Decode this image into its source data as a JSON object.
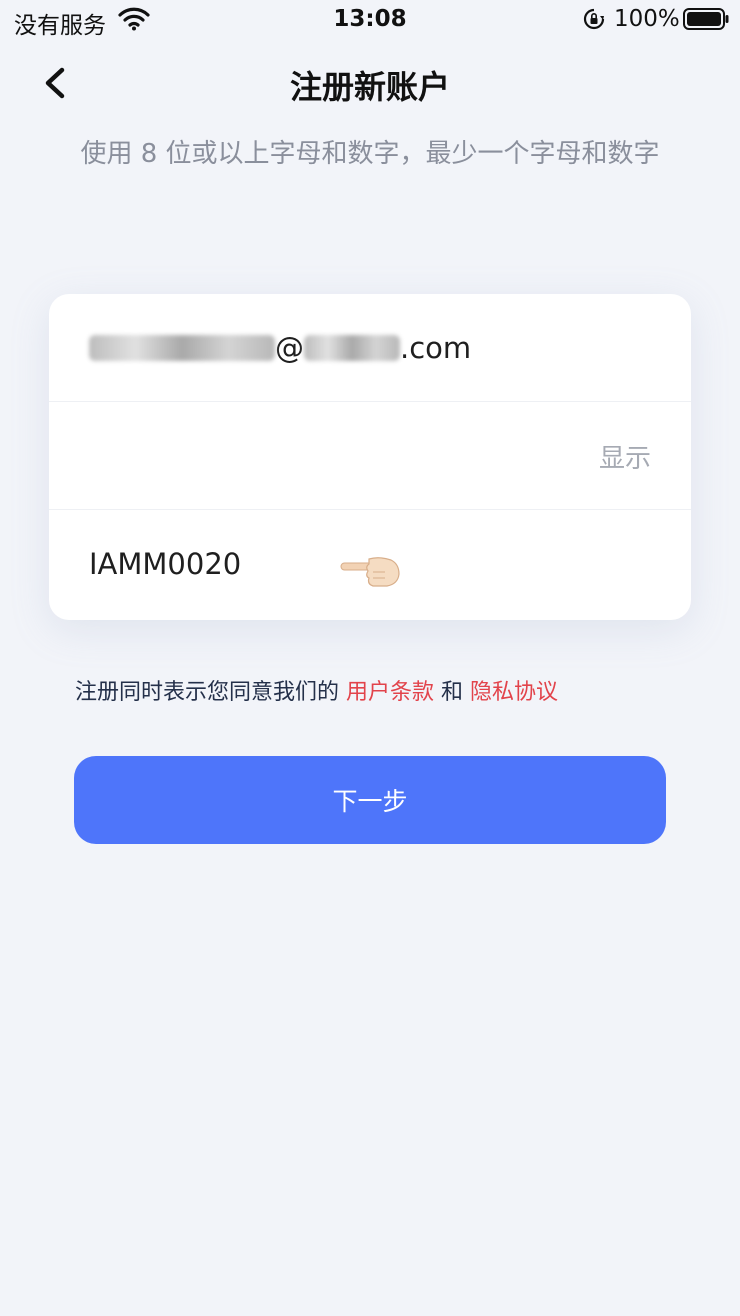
{
  "status_bar": {
    "carrier": "没有服务",
    "time": "13:08",
    "battery": "100%"
  },
  "nav": {
    "title": "注册新账户"
  },
  "hint": "使用 8 位或以上字母和数字，最少一个字母和数字",
  "form": {
    "email_suffix": "@",
    "email_domain_suffix": ".com",
    "password_value": "",
    "show_label": "显示",
    "invite_code": "IAMM0020"
  },
  "terms": {
    "prefix": "注册同时表示您同意我们的",
    "user_terms": "用户条款",
    "and": "和",
    "privacy": "隐私协议"
  },
  "next_button": "下一步",
  "colors": {
    "background": "#f2f4f9",
    "accent": "#4e75fa",
    "link": "#e2434b"
  }
}
